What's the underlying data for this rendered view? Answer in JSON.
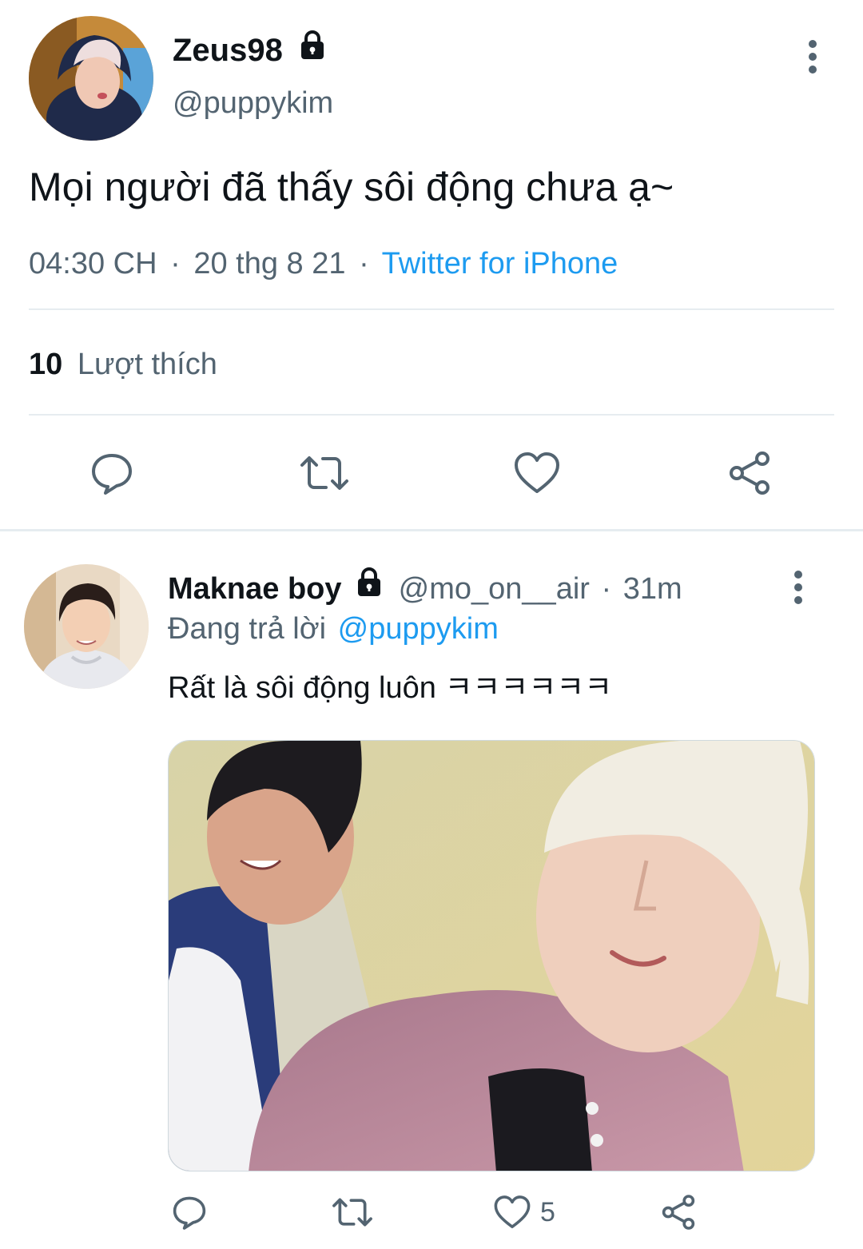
{
  "main_tweet": {
    "display_name": "Zeus98",
    "handle": "@puppykim",
    "text": "Mọi người đã thấy sôi động chưa ạ~",
    "time": "04:30 CH",
    "date": "20 thg 8 21",
    "source": "Twitter for iPhone",
    "separator": "·",
    "like_count": "10",
    "like_label": "Lượt thích",
    "avatar": "avatar-zeus98",
    "lock_icon": "lock-icon",
    "actions": [
      "reply-icon",
      "retweet-icon",
      "like-icon",
      "share-icon"
    ]
  },
  "reply_tweet": {
    "display_name": "Maknae boy",
    "handle": "@mo_on__air",
    "time_ago": "31m",
    "replying_label": "Đang trả lời",
    "replying_to": "@puppykim",
    "text": "Rất là sôi động luôn ㅋㅋㅋㅋㅋㅋ",
    "like_count": "5",
    "avatar": "avatar-maknae-boy",
    "media": "photo of two people",
    "actions": [
      "reply-icon",
      "retweet-icon",
      "like-icon",
      "share-icon"
    ]
  },
  "colors": {
    "text": "#0f1419",
    "muted": "#536471",
    "link": "#1d9bf0",
    "divider": "#e6ecf0"
  }
}
